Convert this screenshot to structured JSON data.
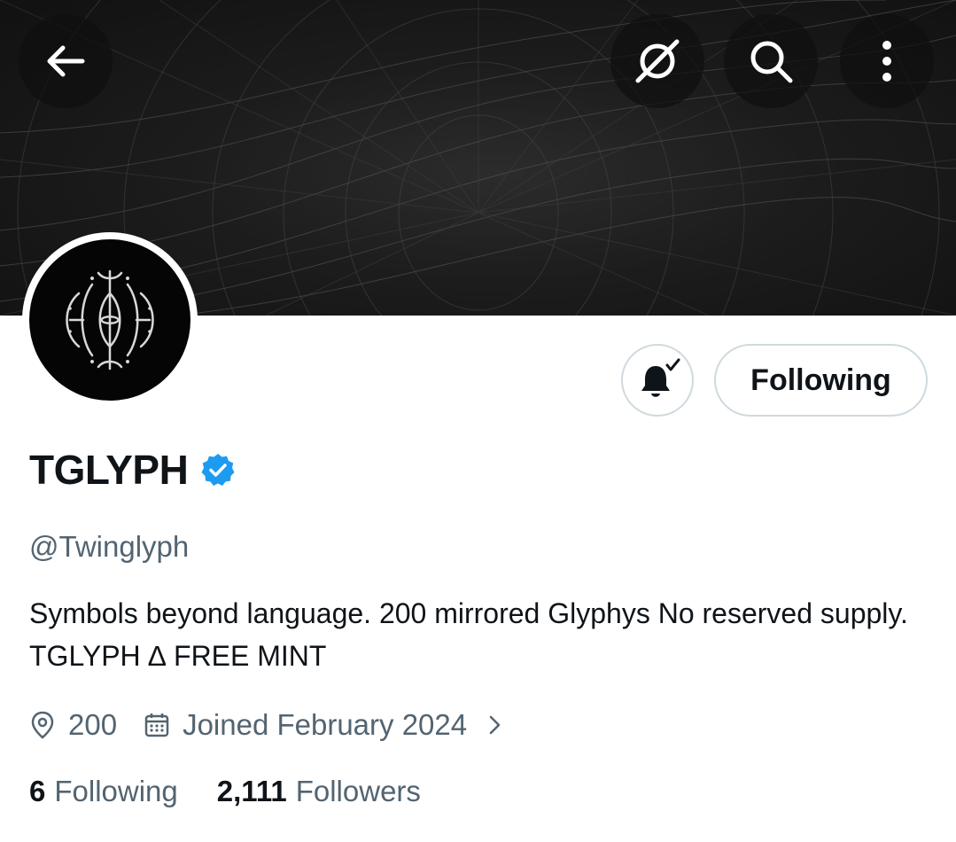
{
  "header": {
    "back_icon": "arrow-left-icon",
    "grok_icon": "grok-icon",
    "search_icon": "search-icon",
    "more_icon": "more-vertical-icon"
  },
  "profile": {
    "display_name": "TGLYPH",
    "verified": true,
    "verified_color": "#1d9bf0",
    "handle": "@Twinglyph",
    "bio": "Symbols beyond language. 200 mirrored Glyphys No reserved supply. TGLYPH ∆  FREE MINT",
    "location": "200",
    "joined": "Joined February 2024",
    "following_count": "6",
    "following_label": "Following",
    "followers_count": "2,111",
    "followers_label": "Followers"
  },
  "actions": {
    "notifications_icon": "bell-check-icon",
    "follow_button_label": "Following"
  },
  "colors": {
    "text_primary": "#0f1419",
    "text_secondary": "#536471",
    "border": "#cfd9de"
  }
}
